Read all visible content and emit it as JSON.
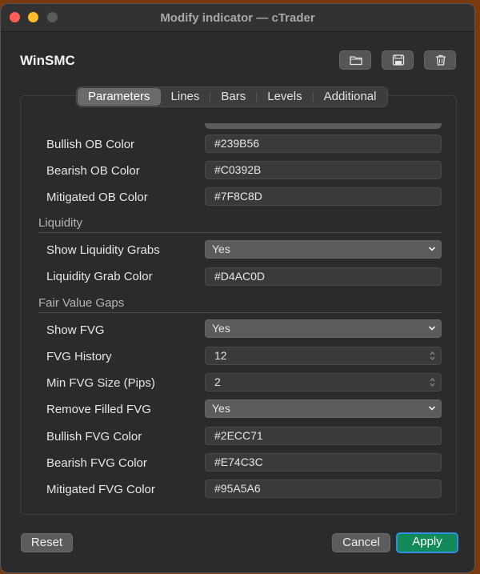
{
  "window": {
    "title": "Modify indicator — cTrader"
  },
  "indicator_name": "WinSMC",
  "toolbar": {
    "open_icon": "folder-icon",
    "save_icon": "save-icon",
    "delete_icon": "trash-icon"
  },
  "tabs": [
    {
      "label": "Parameters",
      "active": true
    },
    {
      "label": "Lines"
    },
    {
      "label": "Bars"
    },
    {
      "label": "Levels"
    },
    {
      "label": "Additional"
    }
  ],
  "rows": {
    "bullish_ob": {
      "label": "Bullish OB Color",
      "value": "#239B56"
    },
    "bearish_ob": {
      "label": "Bearish OB Color",
      "value": "#C0392B"
    },
    "mitigated_ob": {
      "label": "Mitigated OB Color",
      "value": "#7F8C8D"
    },
    "show_liq": {
      "label": "Show Liquidity Grabs",
      "value": "Yes"
    },
    "liq_color": {
      "label": "Liquidity Grab Color",
      "value": "#D4AC0D"
    },
    "show_fvg": {
      "label": "Show FVG",
      "value": "Yes"
    },
    "fvg_history": {
      "label": "FVG History",
      "value": "12"
    },
    "min_fvg": {
      "label": "Min FVG Size (Pips)",
      "value": "2"
    },
    "remove_filled": {
      "label": "Remove Filled FVG",
      "value": "Yes"
    },
    "bullish_fvg": {
      "label": "Bullish FVG Color",
      "value": "#2ECC71"
    },
    "bearish_fvg": {
      "label": "Bearish FVG Color",
      "value": "#E74C3C"
    },
    "mitigated_fvg": {
      "label": "Mitigated FVG Color",
      "value": "#95A5A6"
    }
  },
  "sections": {
    "liquidity": "Liquidity",
    "fvg": "Fair Value Gaps"
  },
  "footer": {
    "reset": "Reset",
    "cancel": "Cancel",
    "apply": "Apply"
  },
  "colors": {
    "apply_bg": "#138a5a",
    "apply_ring": "#2f8fe0",
    "window_bg": "#2b2b2b"
  }
}
